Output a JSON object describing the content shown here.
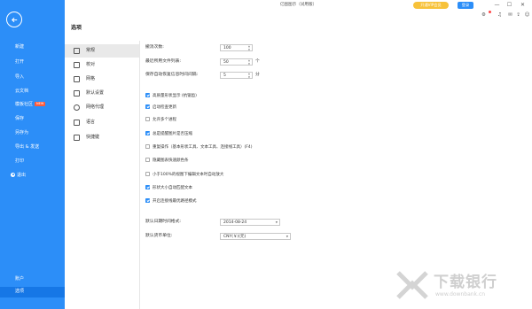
{
  "window": {
    "title": "亿图图示（试用版）",
    "vip_label": "开通VIP会员",
    "login_label": "登录"
  },
  "toolbar_icons": [
    "minimize-icon",
    "maximize-icon",
    "close-icon",
    "settings-icon",
    "bell-icon",
    "gift-icon",
    "share-icon",
    "user-icon"
  ],
  "page_title": "选项",
  "sidebar": {
    "items": [
      {
        "label": "新建"
      },
      {
        "label": "打开"
      },
      {
        "label": "导入"
      },
      {
        "label": "云文档"
      },
      {
        "label": "模板社区",
        "badge": "NEW"
      },
      {
        "label": "保存"
      },
      {
        "label": "另存为"
      },
      {
        "label": "导出 & 发送"
      },
      {
        "label": "打印"
      },
      {
        "label": "退出"
      }
    ],
    "bottom": [
      {
        "label": "账户"
      },
      {
        "label": "选项"
      }
    ]
  },
  "categories": [
    {
      "label": "常规",
      "icon": "general-icon"
    },
    {
      "label": "校对",
      "icon": "proof-icon"
    },
    {
      "label": "网格",
      "icon": "grid-icon"
    },
    {
      "label": "默认设置",
      "icon": "default-settings-icon"
    },
    {
      "label": "网络代理",
      "icon": "proxy-icon"
    },
    {
      "label": "语言",
      "icon": "language-icon"
    },
    {
      "label": "快捷键",
      "icon": "shortcut-icon"
    }
  ],
  "settings": {
    "undo": {
      "label": "撤消次数:",
      "value": "100"
    },
    "recent": {
      "label": "最近所用文件列表:",
      "value": "50",
      "unit": "个"
    },
    "autosave": {
      "label": "保存自动恢复信息时间间隔:",
      "value": "5",
      "unit": "分"
    },
    "checkboxes": [
      {
        "label": "高质量形状显示 (抗锯齿)",
        "checked": true
      },
      {
        "label": "启动检查更新",
        "checked": true
      },
      {
        "label": "允许多个进程",
        "checked": false
      },
      {
        "label": "总是提醒图片是否压缩",
        "checked": true
      },
      {
        "label": "重复操作（基本形状工具、文本工具、连接线工具）(F4)",
        "checked": false
      },
      {
        "label": "隐藏图表快速颜色条",
        "checked": false
      },
      {
        "label": "小于100%的视图下编辑文本时自动放大",
        "checked": false
      },
      {
        "label": "形状大小自动匹配文本",
        "checked": true
      },
      {
        "label": "开启连接线最优路径模式",
        "checked": true
      }
    ],
    "date_format": {
      "label": "默认日期时间格式:",
      "value": "2014-08-24"
    },
    "currency": {
      "label": "默认货币单位:",
      "value": "CNY(￥)(元)"
    }
  },
  "watermark": {
    "text": "下载银行",
    "sub": "www.downbank.cn"
  }
}
